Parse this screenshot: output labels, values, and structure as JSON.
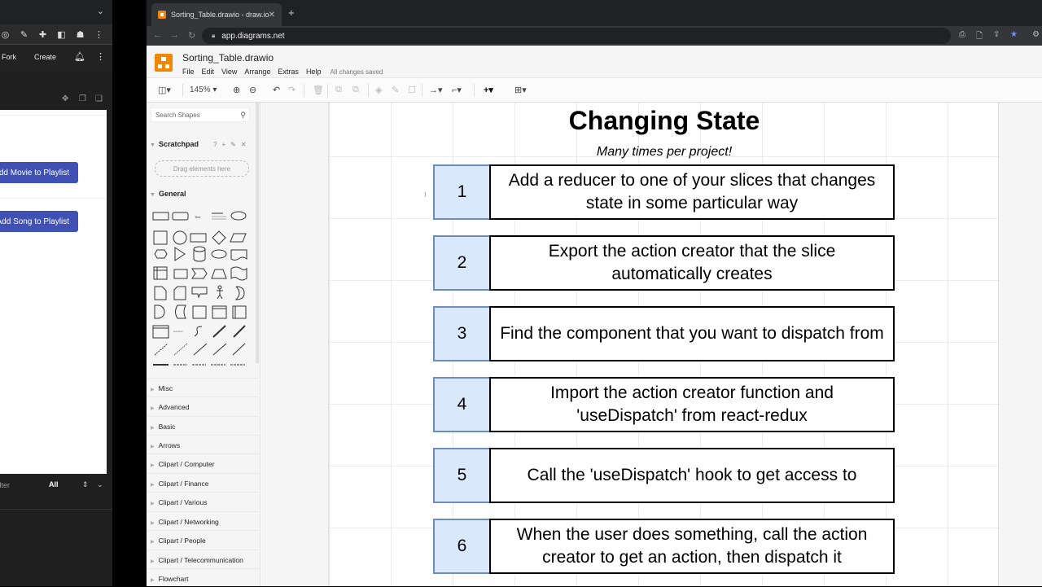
{
  "left_app": {
    "toolbar_buttons": {
      "fork": "Fork",
      "create": "Create"
    },
    "buttons": [
      "Add Movie to Playlist",
      "Add Song to Playlist"
    ],
    "filter": {
      "placeholder": "Filter",
      "selected": "All"
    }
  },
  "browser": {
    "tab_title": "Sorting_Table.drawio - draw.io",
    "url": "app.diagrams.net"
  },
  "drawio": {
    "file_title": "Sorting_Table.drawio",
    "menu": [
      "File",
      "Edit",
      "View",
      "Arrange",
      "Extras",
      "Help"
    ],
    "save_status": "All changes saved",
    "zoom_level": "145%",
    "sidebar": {
      "search_placeholder": "Search Shapes",
      "scratchpad_label": "Scratchpad",
      "scratchpad_drop": "Drag elements here",
      "general_label": "General",
      "categories": [
        "Misc",
        "Advanced",
        "Basic",
        "Arrows",
        "Clipart / Computer",
        "Clipart / Finance",
        "Clipart / Various",
        "Clipart / Networking",
        "Clipart / People",
        "Clipart / Telecommunication",
        "Flowchart"
      ]
    },
    "diagram": {
      "title": "Changing State",
      "subtitle": "Many times per project!",
      "steps": [
        {
          "num": "1",
          "text": "Add a reducer to one of your slices that changes state in some particular way"
        },
        {
          "num": "2",
          "text": "Export the action creator that the slice automatically creates"
        },
        {
          "num": "3",
          "text": "Find the component that you want to dispatch from"
        },
        {
          "num": "4",
          "text": "Import the action creator function and 'useDispatch' from react-redux"
        },
        {
          "num": "5",
          "text": "Call the 'useDispatch' hook to get access to"
        },
        {
          "num": "6",
          "text": "When the user does something, call the action creator to get an action, then dispatch it"
        }
      ],
      "colors": {
        "num_fill": "#dae8fc",
        "num_stroke": "#6c8ebf",
        "text_stroke": "#000000"
      }
    }
  }
}
